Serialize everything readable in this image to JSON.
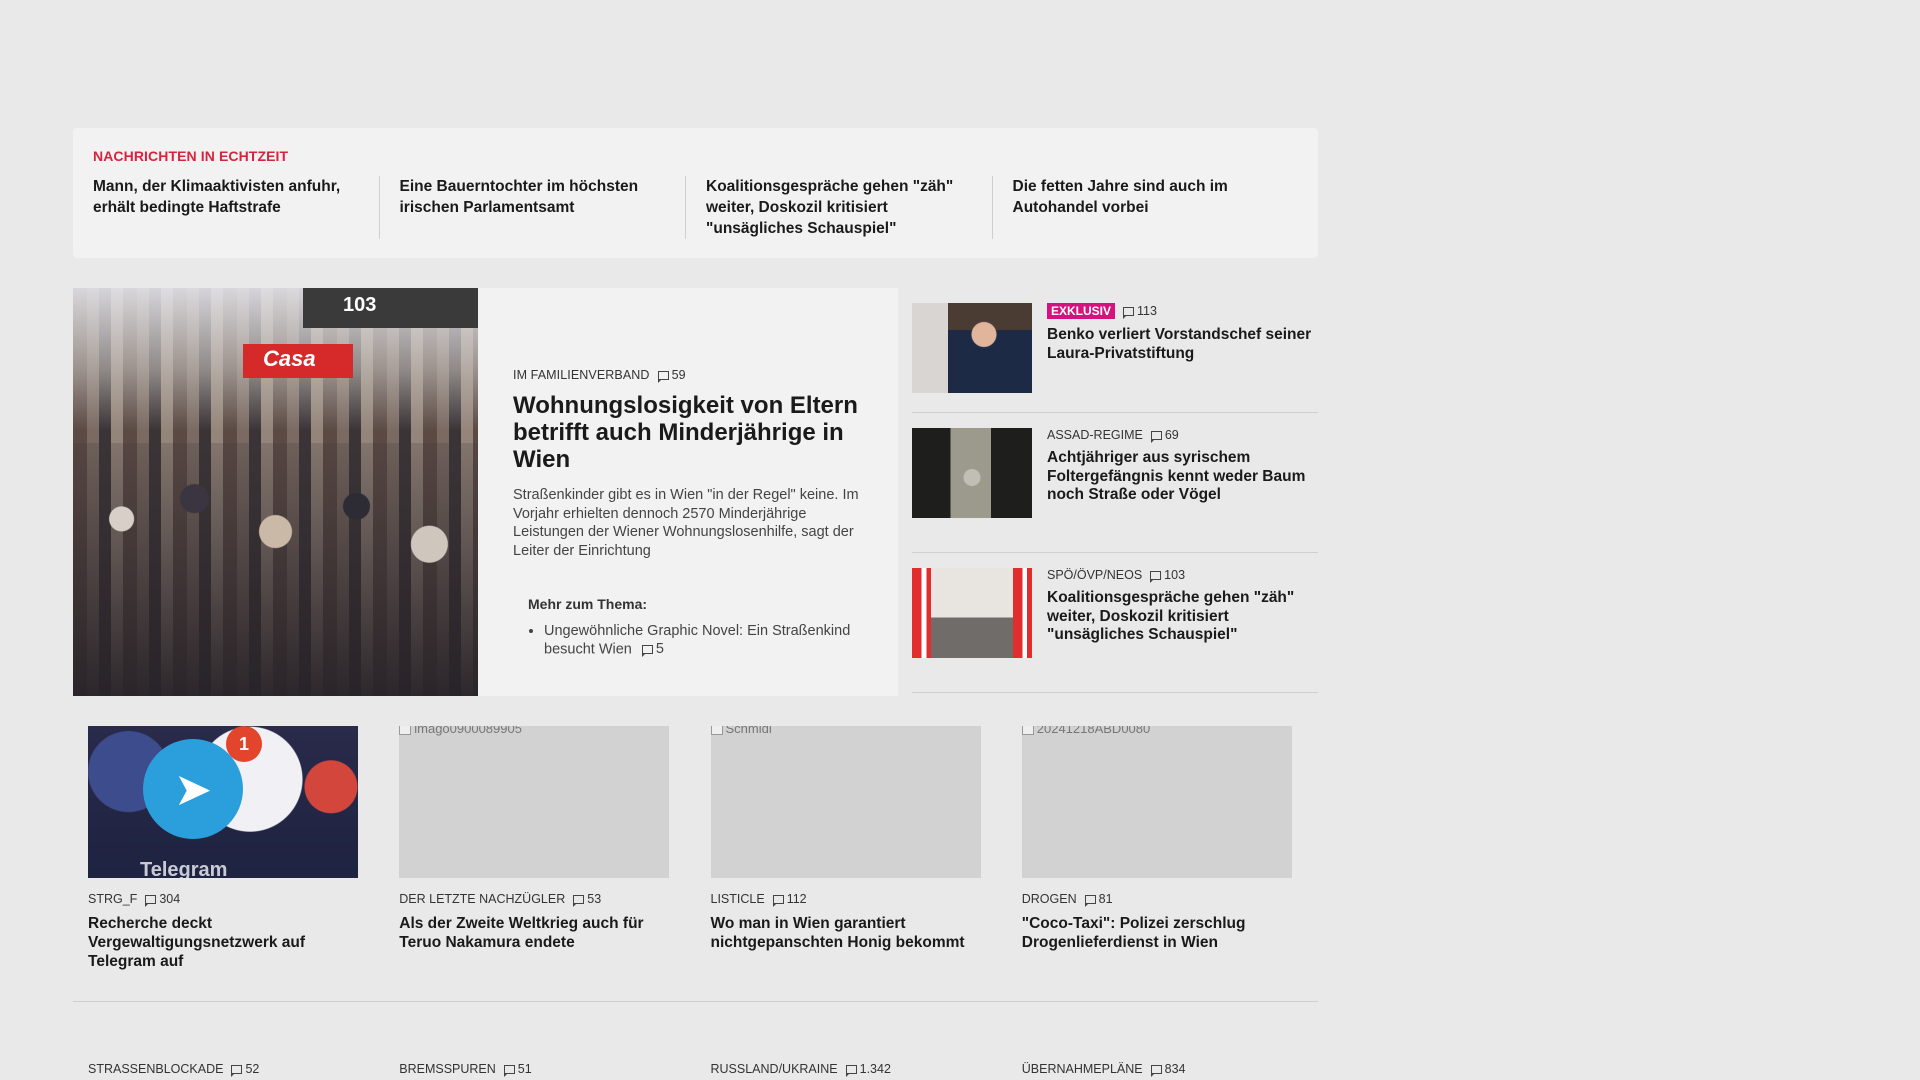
{
  "ticker": {
    "label": "NACHRICHTEN IN ECHTZEIT",
    "items": [
      "Mann, der Klimaaktivisten anfuhr, erhält bedingte Haftstrafe",
      "Eine Bauerntochter im höchsten irischen Parlamentsamt",
      "Koalitionsgespräche gehen \"zäh\" weiter, Doskozil kritisiert \"unsägliches Schauspiel\"",
      "Die fetten Jahre sind auch im Autohandel vorbei"
    ]
  },
  "feature": {
    "image_sign": "103",
    "image_sign2": "Casa",
    "kicker": "IM FAMILIENVERBAND",
    "comments": "59",
    "title": "Wohnungslosigkeit von Eltern betrifft auch Minderjährige in Wien",
    "teaser": "Straßenkinder gibt es in Wien \"in der Regel\" keine. Im Vorjahr erhielten dennoch 2570 Minderjährige Leistungen der Wiener Wohnungslosenhilfe, sagt der Leiter der Einrichtung",
    "related_label": "Mehr zum Thema:",
    "related_item": "Ungewöhnliche Graphic Novel: Ein Straßenkind besucht Wien",
    "related_comments": "5"
  },
  "side": [
    {
      "badge": "EXKLUSIV",
      "kicker": "",
      "comments": "113",
      "title": "Benko verliert Vorstandschef seiner Laura-Privatstiftung"
    },
    {
      "badge": "",
      "kicker": "ASSAD-REGIME",
      "comments": "69",
      "title": "Achtjähriger aus syrischem Foltergefängnis kennt weder Baum noch Straße oder Vögel"
    },
    {
      "badge": "",
      "kicker": "SPÖ/ÖVP/NEOS",
      "comments": "103",
      "title": "Koalitionsgespräche gehen \"zäh\" weiter, Doskozil kritisiert \"unsägliches Schauspiel\""
    }
  ],
  "cards": [
    {
      "img_alt": "",
      "img_badge": "1",
      "img_text": "Telegram",
      "kicker": "STRG_F",
      "comments": "304",
      "title": "Recherche deckt Vergewaltigungsnetzwerk auf Telegram auf"
    },
    {
      "img_alt": "imago0900089905",
      "kicker": "DER LETZTE NACHZÜGLER",
      "comments": "53",
      "title": "Als der Zweite Weltkrieg auch für Teruo Nakamura endete"
    },
    {
      "img_alt": "Schmidl",
      "kicker": "LISTICLE",
      "comments": "112",
      "title": "Wo man in Wien garantiert nichtgepanschten Honig bekommt"
    },
    {
      "img_alt": "20241218ABD0080",
      "kicker": "DROGEN",
      "comments": "81",
      "title": "\"Coco-Taxi\": Polizei zerschlug Drogenlieferdienst in Wien"
    }
  ],
  "bottom": [
    {
      "kicker": "STRASSENBLOCKADE",
      "comments": "52"
    },
    {
      "kicker": "BREMSSPUREN",
      "comments": "51"
    },
    {
      "kicker": "RUSSLAND/UKRAINE",
      "comments": "1.342"
    },
    {
      "kicker": "ÜBERNAHMEPLÄNE",
      "comments": "834"
    }
  ],
  "colors": {
    "background": "#e9e9e9",
    "ticker_label": "#d5253e",
    "badge_exklusiv": "#d6127f"
  }
}
